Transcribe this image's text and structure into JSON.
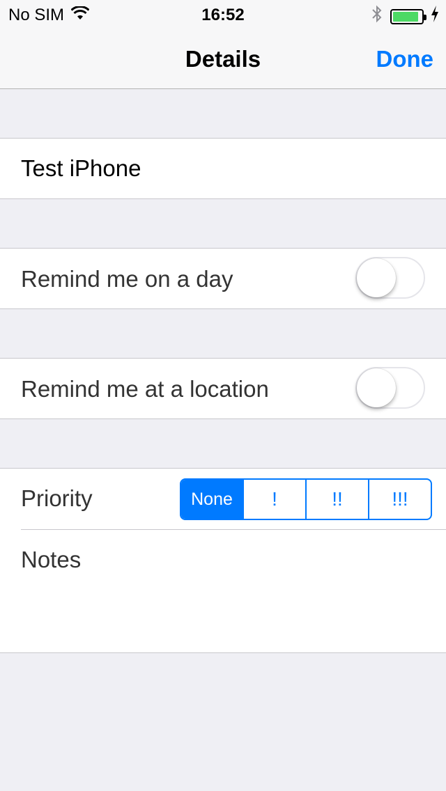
{
  "status_bar": {
    "carrier": "No SIM",
    "time": "16:52",
    "wifi_icon": "wifi-icon",
    "bluetooth_icon": "bluetooth-icon",
    "battery_level": 0.9,
    "charging_icon": "charging-bolt-icon"
  },
  "nav": {
    "title": "Details",
    "done_label": "Done"
  },
  "title_cell": {
    "value": "Test iPhone"
  },
  "remind_day": {
    "label": "Remind me on a day",
    "on": false
  },
  "remind_location": {
    "label": "Remind me at a location",
    "on": false
  },
  "priority": {
    "label": "Priority",
    "options": [
      "None",
      "!",
      "!!",
      "!!!"
    ],
    "selected": "None"
  },
  "notes": {
    "label": "Notes"
  },
  "colors": {
    "accent": "#007aff",
    "background": "#efeff4",
    "battery": "#4cd964"
  }
}
